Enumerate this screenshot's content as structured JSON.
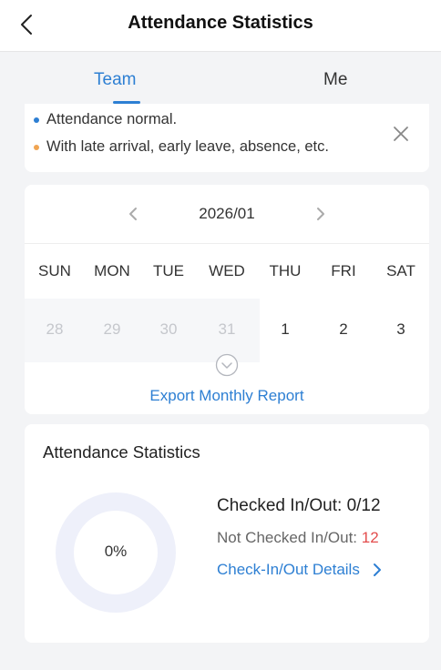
{
  "header": {
    "title": "Attendance Statistics",
    "back_icon": "chevron-left-icon"
  },
  "tabs": [
    {
      "label": "Team",
      "active": true
    },
    {
      "label": "Me",
      "active": false
    }
  ],
  "legend": {
    "items": [
      {
        "text": "Attendance normal.",
        "color": "#2d7fd3"
      },
      {
        "text": "With late arrival, early leave, absence, etc.",
        "color": "#f0a552"
      }
    ],
    "close_icon": "close-icon"
  },
  "calendar": {
    "month": "2026/01",
    "weekdays": [
      "SUN",
      "MON",
      "TUE",
      "WED",
      "THU",
      "FRI",
      "SAT"
    ],
    "days": [
      {
        "label": "28",
        "in_month": false
      },
      {
        "label": "29",
        "in_month": false
      },
      {
        "label": "30",
        "in_month": false
      },
      {
        "label": "31",
        "in_month": false
      },
      {
        "label": "1",
        "in_month": true
      },
      {
        "label": "2",
        "in_month": true
      },
      {
        "label": "3",
        "in_month": true
      }
    ],
    "export_label": "Export Monthly Report"
  },
  "stats": {
    "title": "Attendance Statistics",
    "percent_label": "0%",
    "checked_label": "Checked In/Out:",
    "checked_value": "0/12",
    "unchecked_label": "Not Checked In/Out:",
    "unchecked_value": "12",
    "details_label": "Check-In/Out Details",
    "progress_fraction": 0,
    "colors": {
      "ring": "#eef0fa",
      "accent": "#2d7fd3",
      "alert": "#e34d4d"
    }
  }
}
